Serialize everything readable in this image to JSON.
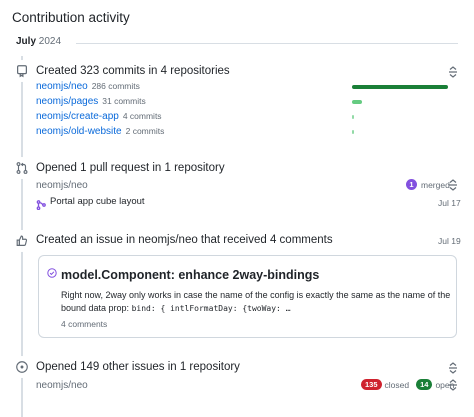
{
  "section": {
    "title": "Contribution activity"
  },
  "month": {
    "name": "July",
    "year": "2024"
  },
  "colors": {
    "bar_dark": "#1a7f37",
    "bar_light": "#4ac26b",
    "link": "#0969da",
    "merged": "#8250df",
    "closed": "#cf222e",
    "open": "#1a7f37"
  },
  "commits": {
    "title": "Created 323 commits in 4 repositories",
    "icon": "repo-push-icon",
    "repos": [
      {
        "name": "neomjs/neo",
        "count": "286 commits",
        "share": 0.885
      },
      {
        "name": "neomjs/pages",
        "count": "31 commits",
        "share": 0.096
      },
      {
        "name": "neomjs/create-app",
        "count": "4 commits",
        "share": 0.012
      },
      {
        "name": "neomjs/old-website",
        "count": "2 commits",
        "share": 0.006
      }
    ]
  },
  "pull_requests": {
    "title": "Opened 1 pull request in 1 repository",
    "icon": "git-pull-request-icon",
    "repo": "neomjs/neo",
    "merged_count": "1",
    "merged_label": "merged",
    "items": [
      {
        "title": "Portal app cube layout",
        "date": "Jul 17"
      }
    ]
  },
  "issue_comments": {
    "title": "Created an issue in neomjs/neo that received 4 comments",
    "date": "Jul 19",
    "icon": "thumbs-up-icon",
    "card": {
      "title": "model.Component: enhance 2way-bindings",
      "text_line1": "Right now, 2way only works in case the name of the config is exactly the same as the name of the",
      "text_line2_prefix": "bound data prop: ",
      "text_line2_code": "bind: { intlFormatDay: {twoWay: …",
      "comments": "4 comments"
    }
  },
  "other_issues": {
    "title": "Opened 149 other issues in 1 repository",
    "icon": "issue-opened-icon",
    "repo": "neomjs/neo",
    "closed_count": "135",
    "closed_label": "closed",
    "open_count": "14",
    "open_label": "open"
  }
}
